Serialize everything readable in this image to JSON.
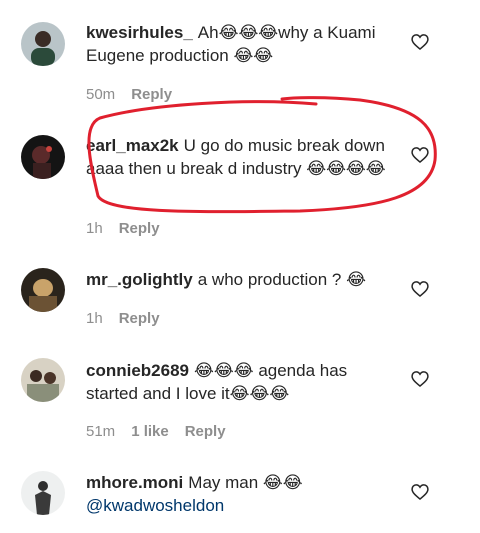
{
  "comments": [
    {
      "username": "kwesirhules_",
      "text": "Ah😂😂😂why a Kuami Eugene production 😂😂",
      "time": "50m",
      "likes": "",
      "reply_label": "Reply"
    },
    {
      "username": "earl_max2k",
      "text": "U go do music break down aaaa then u break d industry 😂😂😂😂",
      "time": "1h",
      "likes": "",
      "reply_label": "Reply"
    },
    {
      "username": "mr_.golightly",
      "text": "a who production ? 😂",
      "time": "1h",
      "likes": "",
      "reply_label": "Reply"
    },
    {
      "username": "connieb2689",
      "text": "😂😂😂 agenda has started and I love it😂😂😂",
      "time": "51m",
      "likes": "1 like",
      "reply_label": "Reply"
    },
    {
      "username": "mhore.moni",
      "text": "May man 😂😂",
      "mention": "@kwadwosheldon",
      "time": "",
      "likes": "",
      "reply_label": ""
    }
  ],
  "icons": {
    "like": "heart-outline-icon"
  },
  "colors": {
    "text": "#262626",
    "meta": "#8e8e8e",
    "mention": "#00376b",
    "annotation": "#e0202e"
  }
}
